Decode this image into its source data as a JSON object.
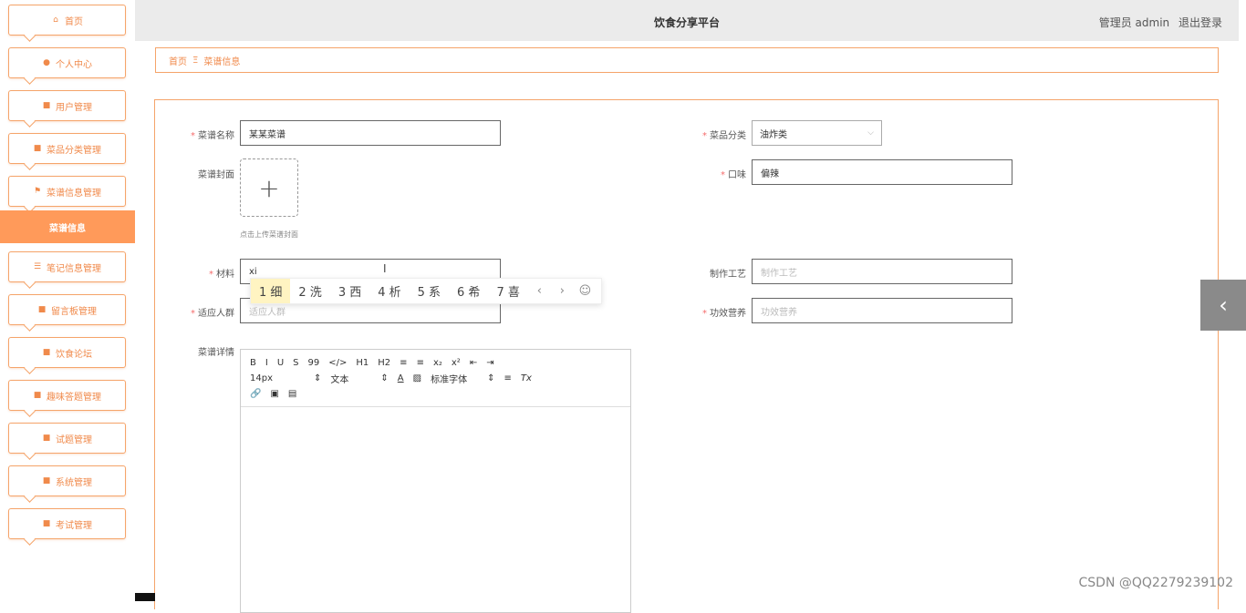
{
  "sidebar": {
    "items": [
      {
        "label": "首页",
        "icon": "home-icon",
        "glyph": "⌂"
      },
      {
        "label": "个人中心",
        "icon": "user-icon",
        "glyph": "●"
      },
      {
        "label": "用户管理",
        "icon": "grid-icon",
        "glyph": "■"
      },
      {
        "label": "菜品分类管理",
        "icon": "grid-icon",
        "glyph": "■"
      },
      {
        "label": "菜谱信息管理",
        "icon": "flag-icon",
        "glyph": "⚑"
      },
      {
        "label": "菜谱信息",
        "icon": "",
        "glyph": "",
        "active": true
      },
      {
        "label": "笔记信息管理",
        "icon": "sliders-icon",
        "glyph": "☰"
      },
      {
        "label": "留言板管理",
        "icon": "thumb-icon",
        "glyph": "■"
      },
      {
        "label": "饮食论坛",
        "icon": "grid-icon",
        "glyph": "■"
      },
      {
        "label": "趣味答题管理",
        "icon": "monitor-icon",
        "glyph": "■"
      },
      {
        "label": "试题管理",
        "icon": "doc-icon",
        "glyph": "■"
      },
      {
        "label": "系统管理",
        "icon": "grid-icon",
        "glyph": "■"
      },
      {
        "label": "考试管理",
        "icon": "grid-icon",
        "glyph": "■"
      }
    ]
  },
  "header": {
    "title": "饮食分享平台",
    "user": "管理员 admin",
    "logout": "退出登录"
  },
  "breadcrumb": {
    "home": "首页",
    "separator": "Ξ",
    "current": "菜谱信息"
  },
  "form": {
    "recipe_name": {
      "label": "菜谱名称",
      "value": "某某菜谱"
    },
    "category": {
      "label": "菜品分类",
      "value": "油炸类"
    },
    "cover": {
      "label": "菜谱封面",
      "plus": "+",
      "hint": "点击上传菜谱封面"
    },
    "taste": {
      "label": "口味",
      "value": "偏辣"
    },
    "material": {
      "label": "材料",
      "value": "xi"
    },
    "craft": {
      "label": "制作工艺",
      "placeholder": "制作工艺"
    },
    "audience": {
      "label": "适应人群",
      "placeholder": "适应人群"
    },
    "nutrition": {
      "label": "功效营养",
      "placeholder": "功效营养"
    },
    "details": {
      "label": "菜谱详情"
    }
  },
  "ime": {
    "candidates": [
      "1 细",
      "2 洗",
      "3 西",
      "4 析",
      "5 系",
      "6 希",
      "7 喜"
    ],
    "prev": "‹",
    "next": "›",
    "emoji": "☺"
  },
  "editor": {
    "row1": [
      "B",
      "I",
      "U",
      "S",
      "99",
      "</>",
      "H1",
      "H2",
      "≡",
      "≡",
      "x₂",
      "x²",
      "⇤",
      "⇥"
    ],
    "font_size": "14px",
    "text_type": "文本",
    "font_color": "A",
    "font_family": "标准字体",
    "clear": "Tx",
    "row3": [
      "🔗",
      "▣",
      "▤"
    ]
  },
  "side_tab": {
    "glyph": "‹"
  },
  "watermark": "CSDN @QQ2279239102",
  "colors": {
    "accent": "#f08a4b",
    "accent_bg": "#ff9a5a",
    "required": "#f56c6c"
  }
}
